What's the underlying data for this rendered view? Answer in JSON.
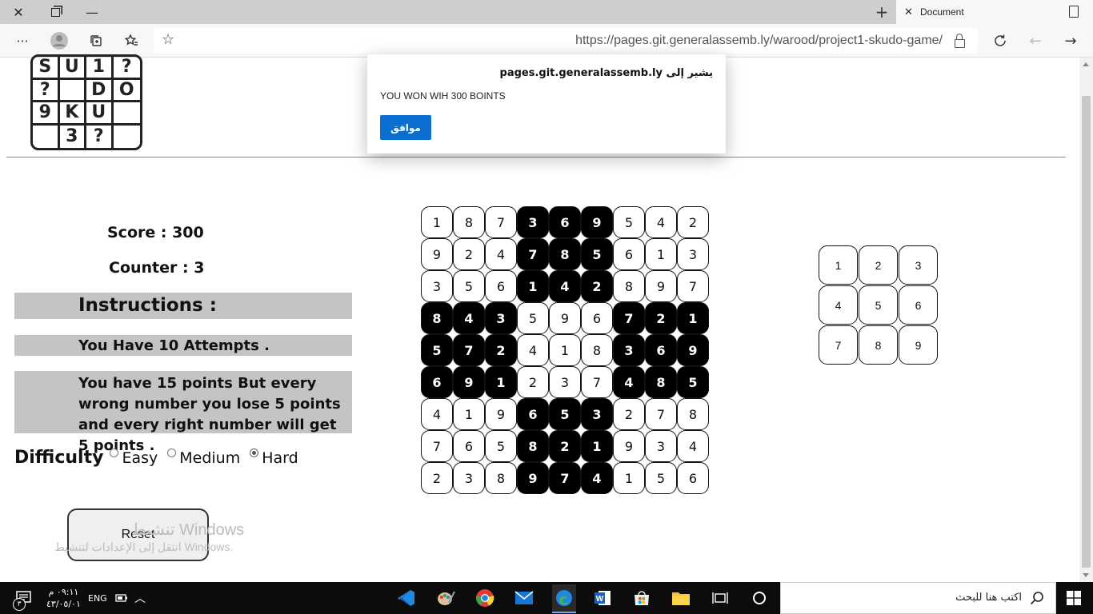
{
  "browser": {
    "tab_title": "Document",
    "url": "https://pages.git.generalassemb.ly/warood/project1-skudo-game/",
    "more_label": "···"
  },
  "logo": {
    "cells": [
      "S",
      "U",
      "1",
      "?",
      "?",
      "",
      "D",
      "O",
      "9",
      "K",
      "U",
      "",
      "",
      "3",
      "?",
      ""
    ]
  },
  "game": {
    "score_label": "Score : 300",
    "counter_label": "Counter : 3",
    "instructions_title": "Instructions :",
    "instruction_attempts": "You Have 10 Attempts .",
    "instruction_points": "You have 15 points But every wrong number you lose 5 points and every right number will get 5 points .",
    "difficulty_label": "Difficulty",
    "difficulty_options": [
      "Easy",
      "Medium",
      "Hard"
    ],
    "difficulty_selected": "Hard",
    "reset_label": "Reset"
  },
  "board": {
    "rows": [
      [
        1,
        8,
        7,
        3,
        6,
        9,
        5,
        4,
        2
      ],
      [
        9,
        2,
        4,
        7,
        8,
        5,
        6,
        1,
        3
      ],
      [
        3,
        5,
        6,
        1,
        4,
        2,
        8,
        9,
        7
      ],
      [
        8,
        4,
        3,
        5,
        9,
        6,
        7,
        2,
        1
      ],
      [
        5,
        7,
        2,
        4,
        1,
        8,
        3,
        6,
        9
      ],
      [
        6,
        9,
        1,
        2,
        3,
        7,
        4,
        8,
        5
      ],
      [
        4,
        1,
        9,
        6,
        5,
        3,
        2,
        7,
        8
      ],
      [
        7,
        6,
        5,
        8,
        2,
        1,
        9,
        3,
        4
      ],
      [
        2,
        3,
        8,
        9,
        7,
        4,
        1,
        5,
        6
      ]
    ],
    "shading": "alternating 3x3 blocks dark/light"
  },
  "number_pad": [
    1,
    2,
    3,
    4,
    5,
    6,
    7,
    8,
    9
  ],
  "alert": {
    "header": "يشير إلى pages.git.generalassemb.ly",
    "message": "YOU WON WIH 300 BOINTS",
    "ok_label": "موافق"
  },
  "watermark": {
    "line1": "تنشيط Windows",
    "line2": "انتقل إلى الإعدادات لتنشيط Windows."
  },
  "taskbar": {
    "search_placeholder": "اكتب هنا للبحث",
    "language": "ENG",
    "time": "٠٩:١١ م",
    "date": "٤٣/٠٥/٠١",
    "notification_count": "٣"
  },
  "colors": {
    "dark_cell": "#000000",
    "instruction_bg": "#c5c3c6",
    "alert_button": "#0a6fd1",
    "taskbar": "#0c0c0c"
  }
}
